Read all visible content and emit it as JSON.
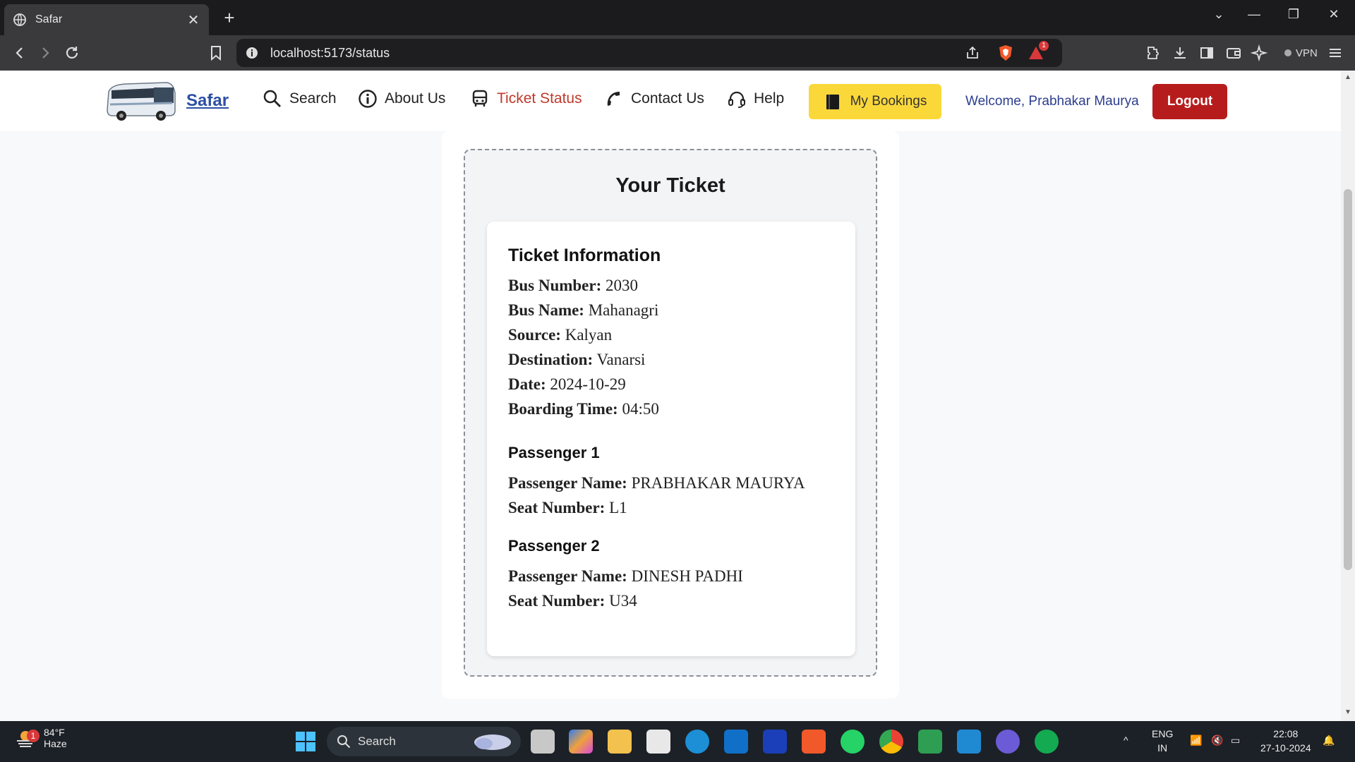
{
  "browser": {
    "tab_title": "Safar",
    "url": "localhost:5173/status",
    "vpn_label": "VPN",
    "notification_count": "1"
  },
  "navbar": {
    "brand": "Safar",
    "items": [
      {
        "label": "Search",
        "icon": "search-icon"
      },
      {
        "label": "About Us",
        "icon": "info-icon"
      },
      {
        "label": "Ticket Status",
        "icon": "bus-icon"
      },
      {
        "label": "Contact Us",
        "icon": "phone-icon"
      },
      {
        "label": "Help",
        "icon": "headset-icon"
      }
    ],
    "bookings_label": "My Bookings",
    "welcome": "Welcome, Prabhakar Maurya",
    "logout_label": "Logout"
  },
  "ticket": {
    "title": "Your Ticket",
    "info_heading": "Ticket Information",
    "fields": [
      {
        "label": "Bus Number:",
        "value": "2030"
      },
      {
        "label": "Bus Name:",
        "value": "Mahanagri"
      },
      {
        "label": "Source:",
        "value": "Kalyan"
      },
      {
        "label": "Destination:",
        "value": "Vanarsi"
      },
      {
        "label": "Date:",
        "value": "2024-10-29"
      },
      {
        "label": "Boarding Time:",
        "value": "04:50"
      }
    ],
    "passengers": [
      {
        "heading": "Passenger 1",
        "name_label": "Passenger Name:",
        "name": "PRABHAKAR MAURYA",
        "seat_label": "Seat Number:",
        "seat": "L1"
      },
      {
        "heading": "Passenger 2",
        "name_label": "Passenger Name:",
        "name": "DINESH PADHI",
        "seat_label": "Seat Number:",
        "seat": "U34"
      }
    ]
  },
  "taskbar": {
    "weather_temp": "84°F",
    "weather_desc": "Haze",
    "weather_badge": "1",
    "search_label": "Search",
    "lang_top": "ENG",
    "lang_bottom": "IN",
    "time": "22:08",
    "date": "27-10-2024"
  },
  "colors": {
    "accent_blue": "#2c4fa3",
    "active_red": "#c0392b",
    "bookings_yellow": "#fbd83a",
    "logout_red": "#b71c1c",
    "footer_navy": "#1e3a8a"
  }
}
